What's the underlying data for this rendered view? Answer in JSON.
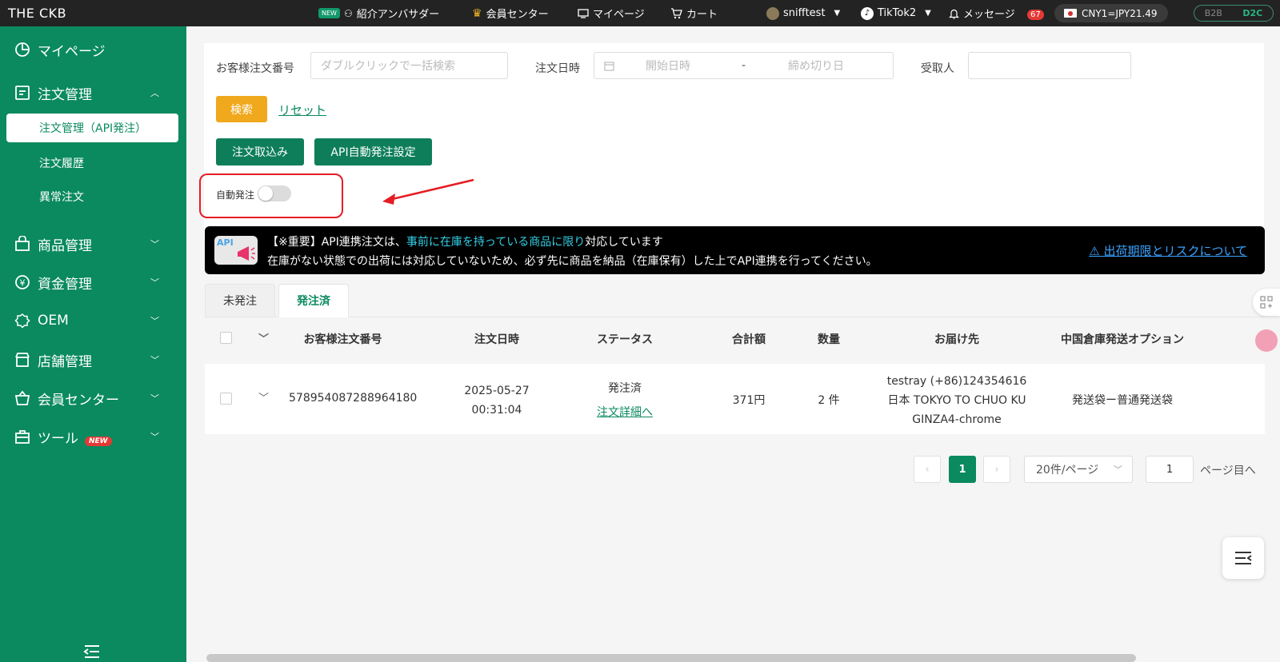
{
  "topbar": {
    "logo": "THE CKB",
    "new_tag": "NEW",
    "ambassador": "紹介アンバサダー",
    "member_center": "会員センター",
    "mypage": "マイページ",
    "cart": "カート",
    "user": "snifftest",
    "shop": "TikTok2",
    "messages": "メッセージ",
    "message_count": "67",
    "rate": "CNY1=JPY21.49",
    "mode_b2b": "B2B",
    "mode_d2c": "D2C"
  },
  "sidebar": {
    "mypage": "マイページ",
    "order_mgmt": "注文管理",
    "sub_api": "注文管理（API発注）",
    "sub_history": "注文履歴",
    "sub_abnormal": "異常注文",
    "product_mgmt": "商品管理",
    "fund_mgmt": "資金管理",
    "oem": "OEM",
    "store_mgmt": "店舗管理",
    "member_center": "会員センター",
    "tools": "ツール",
    "tools_badge": "NEW"
  },
  "filters": {
    "order_no_label": "お客様注文番号",
    "order_no_placeholder": "ダブルクリックで一括検索",
    "date_label": "注文日時",
    "start_placeholder": "開始日時",
    "separator": "-",
    "end_placeholder": "締め切り日",
    "recipient_label": "受取人",
    "search_button": "検索",
    "reset_link": "リセット"
  },
  "actions": {
    "import_button": "注文取込み",
    "api_setting_button": "API自動発注設定",
    "auto_order_label": "自動発注",
    "auto_order_enabled": false
  },
  "notice": {
    "icon_text": "API",
    "line1_prefix": "【※重要】API連携注文は、",
    "line1_highlight": "事前に在庫を持っている商品に限り",
    "line1_suffix": "対応しています",
    "line2": "在庫がない状態での出荷には対応していないため、必ず先に商品を納品（在庫保有）した上でAPI連携を行ってください。",
    "risk_link": "出荷期限とリスクについて"
  },
  "tabs": [
    {
      "label": "未発注"
    },
    {
      "label": "発注済"
    }
  ],
  "table": {
    "headers": [
      "お客様注文番号",
      "注文日時",
      "ステータス",
      "合計額",
      "数量",
      "お届け先",
      "中国倉庫発送オプション"
    ],
    "rows": [
      {
        "order_no": "578954087288964180",
        "date": "2025-05-27",
        "time": "00:31:04",
        "status": "発注済",
        "detail_link": "注文詳細へ",
        "total": "371円",
        "qty": "2 件",
        "address1": "testray (+86)124354616",
        "address2": "日本 TOKYO TO CHUO KU",
        "address3": "GINZA4-chrome",
        "option": "発送袋ー普通発送袋"
      }
    ]
  },
  "pagination": {
    "current": "1",
    "per_page": "20件/ページ",
    "goto_value": "1",
    "goto_label": "ページ目へ"
  },
  "colors": {
    "brand_green": "#0a8a5e",
    "search_yellow": "#f0a81c",
    "annotation_red": "#e51c23"
  }
}
